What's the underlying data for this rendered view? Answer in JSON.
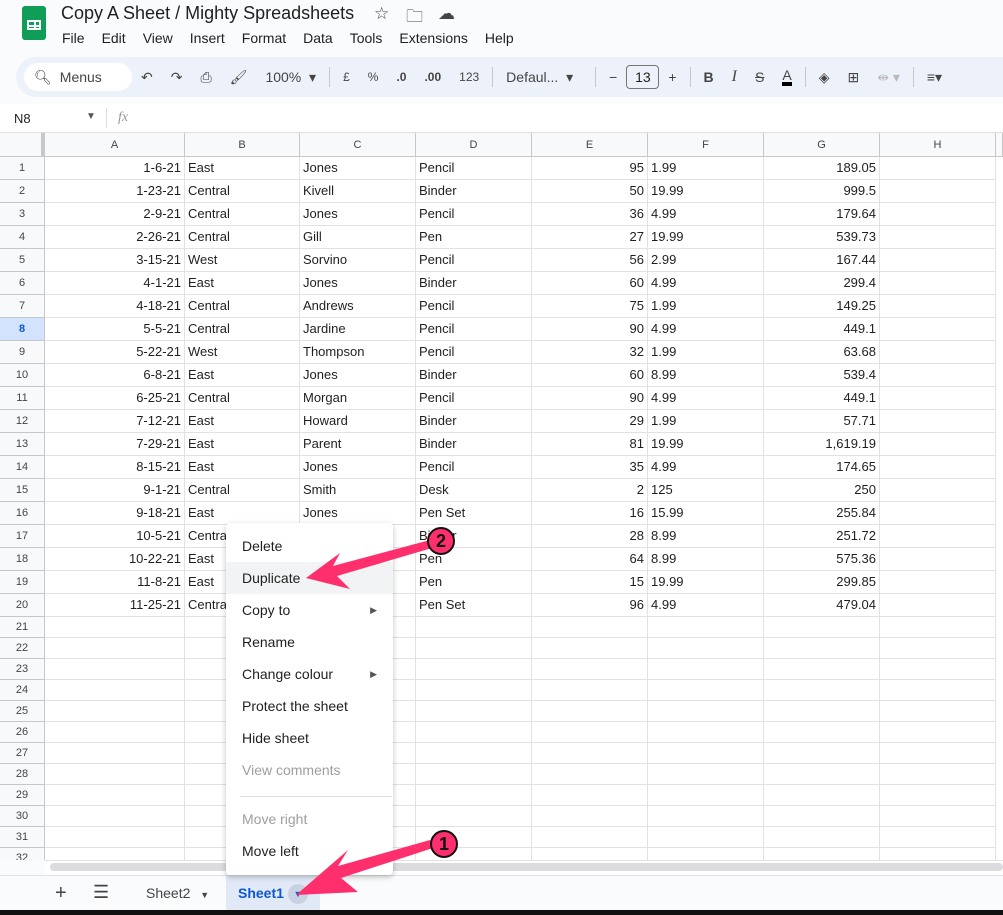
{
  "app": {
    "title": "Copy A Sheet / Mighty Spreadsheets",
    "icons": [
      "star-icon",
      "move-folder-icon",
      "cloud-icon"
    ]
  },
  "menubar": [
    "File",
    "Edit",
    "View",
    "Insert",
    "Format",
    "Data",
    "Tools",
    "Extensions",
    "Help"
  ],
  "toolbar": {
    "search": "Menus",
    "zoom": "100%",
    "currency": "£",
    "percent": "%",
    "dec_less": ".0",
    "dec_more": ".00",
    "number_format": "123",
    "font": "Defaul...",
    "font_size": "13",
    "bold": "B",
    "italic": "I",
    "text_color": "#000000"
  },
  "formula_bar": {
    "name_box": "N8",
    "fx": "fx",
    "value": ""
  },
  "columns": [
    "A",
    "B",
    "C",
    "D",
    "E",
    "F",
    "G",
    "H"
  ],
  "selected_row": 8,
  "rows": [
    [
      "1-6-21",
      "East",
      "Jones",
      "Pencil",
      "95",
      "1.99",
      "189.05"
    ],
    [
      "1-23-21",
      "Central",
      "Kivell",
      "Binder",
      "50",
      "19.99",
      "999.5"
    ],
    [
      "2-9-21",
      "Central",
      "Jones",
      "Pencil",
      "36",
      "4.99",
      "179.64"
    ],
    [
      "2-26-21",
      "Central",
      "Gill",
      "Pen",
      "27",
      "19.99",
      "539.73"
    ],
    [
      "3-15-21",
      "West",
      "Sorvino",
      "Pencil",
      "56",
      "2.99",
      "167.44"
    ],
    [
      "4-1-21",
      "East",
      "Jones",
      "Binder",
      "60",
      "4.99",
      "299.4"
    ],
    [
      "4-18-21",
      "Central",
      "Andrews",
      "Pencil",
      "75",
      "1.99",
      "149.25"
    ],
    [
      "5-5-21",
      "Central",
      "Jardine",
      "Pencil",
      "90",
      "4.99",
      "449.1"
    ],
    [
      "5-22-21",
      "West",
      "Thompson",
      "Pencil",
      "32",
      "1.99",
      "63.68"
    ],
    [
      "6-8-21",
      "East",
      "Jones",
      "Binder",
      "60",
      "8.99",
      "539.4"
    ],
    [
      "6-25-21",
      "Central",
      "Morgan",
      "Pencil",
      "90",
      "4.99",
      "449.1"
    ],
    [
      "7-12-21",
      "East",
      "Howard",
      "Binder",
      "29",
      "1.99",
      "57.71"
    ],
    [
      "7-29-21",
      "East",
      "Parent",
      "Binder",
      "81",
      "19.99",
      "1,619.19"
    ],
    [
      "8-15-21",
      "East",
      "Jones",
      "Pencil",
      "35",
      "4.99",
      "174.65"
    ],
    [
      "9-1-21",
      "Central",
      "Smith",
      "Desk",
      "2",
      "125",
      "250"
    ],
    [
      "9-18-21",
      "East",
      "Jones",
      "Pen Set",
      "16",
      "15.99",
      "255.84"
    ],
    [
      "10-5-21",
      "Central",
      "",
      "Binder",
      "28",
      "8.99",
      "251.72"
    ],
    [
      "10-22-21",
      "East",
      "",
      "Pen",
      "64",
      "8.99",
      "575.36"
    ],
    [
      "11-8-21",
      "East",
      "",
      "Pen",
      "15",
      "19.99",
      "299.85"
    ],
    [
      "11-25-21",
      "Central",
      "",
      "Pen Set",
      "96",
      "4.99",
      "479.04"
    ]
  ],
  "total_row_labels": 32,
  "context_menu": [
    {
      "label": "Delete",
      "disabled": false
    },
    {
      "label": "Duplicate",
      "disabled": false,
      "highlighted": true
    },
    {
      "label": "Copy to",
      "disabled": false,
      "submenu": true
    },
    {
      "label": "Rename",
      "disabled": false
    },
    {
      "label": "Change colour",
      "disabled": false,
      "submenu": true
    },
    {
      "label": "Protect the sheet",
      "disabled": false
    },
    {
      "label": "Hide sheet",
      "disabled": false
    },
    {
      "label": "View comments",
      "disabled": true
    },
    {
      "label": "Move right",
      "disabled": true
    },
    {
      "label": "Move left",
      "disabled": false
    }
  ],
  "tabs": [
    {
      "label": "Sheet2"
    },
    {
      "label": "Sheet1",
      "active": true
    }
  ],
  "annotations": [
    {
      "label": "1"
    },
    {
      "label": "2"
    }
  ],
  "colors": {
    "accent": "#0b57d0",
    "annotation": "#ff2f6e",
    "brand": "#0f9d58"
  }
}
